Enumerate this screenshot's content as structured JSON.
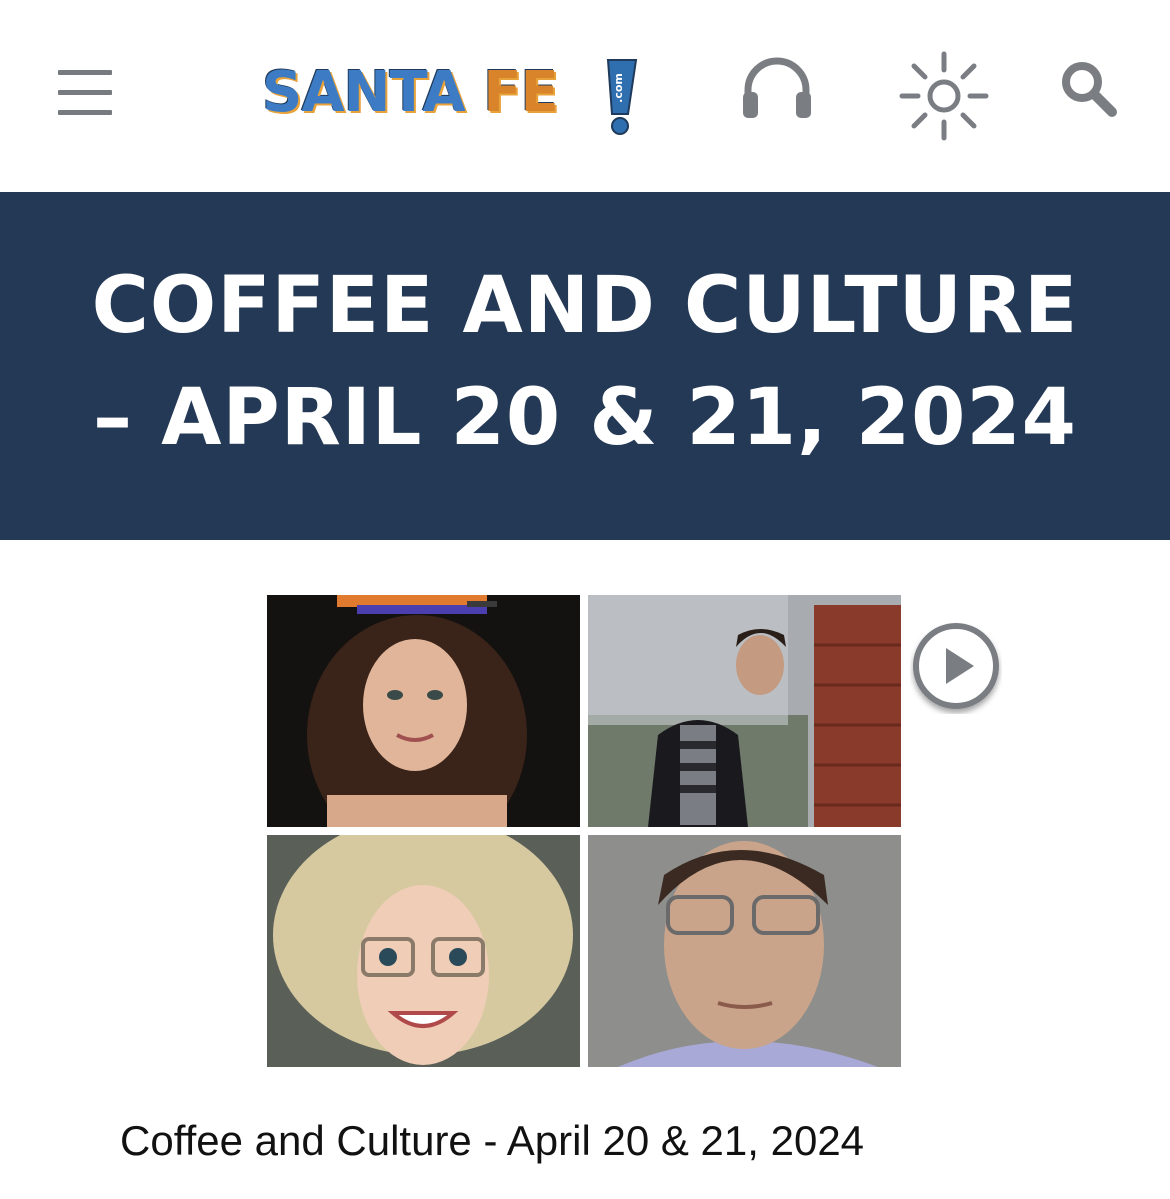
{
  "header": {
    "menu_icon": "hamburger-menu-icon",
    "logo": {
      "text_left": "SANTA",
      "text_right": "FE",
      "suffix": ".com"
    },
    "icons": [
      "headphones-icon",
      "sun-icon",
      "search-icon"
    ]
  },
  "banner": {
    "title_line1": "COFFEE AND CULTURE",
    "title_line2": "– APRIL 20 & 21, 2024",
    "background_color": "#243955"
  },
  "media": {
    "photos": [
      "woman-with-books-on-head-photo",
      "man-in-glasses-by-barn-photo",
      "curly-blonde-woman-glasses-photo",
      "man-in-glasses-portrait-photo"
    ],
    "play_icon": "play-button-icon"
  },
  "caption": {
    "text": "Coffee and Culture - April 20 & 21, 2024"
  }
}
